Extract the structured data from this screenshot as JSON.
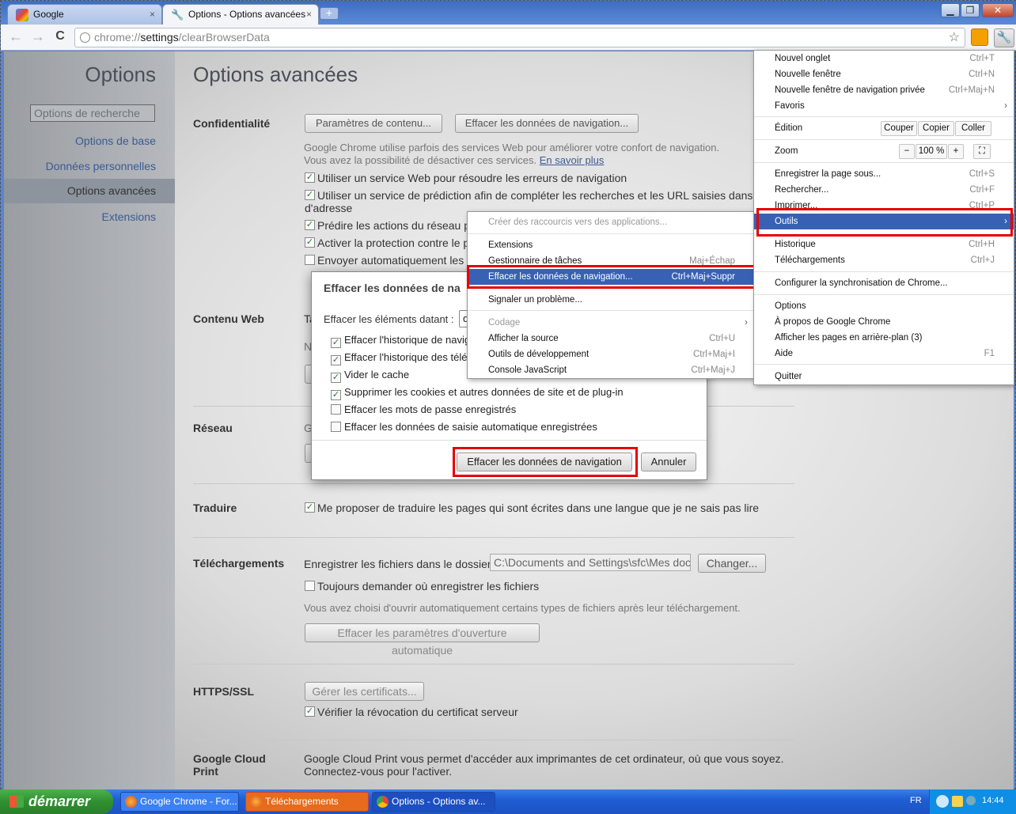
{
  "tabs": [
    {
      "title": "Google",
      "close": "×"
    },
    {
      "title": "Options - Options avancées",
      "close": "×"
    }
  ],
  "new_tab_label": "+",
  "window_controls": {
    "minimize": "▁",
    "maximize": "❐",
    "close": "✕"
  },
  "toolbar": {
    "back": "←",
    "forward": "→",
    "reload": "C",
    "url_scheme": "chrome://",
    "url_host": "settings",
    "url_path": "/clearBrowserData",
    "star": "☆",
    "wrench": "🔧"
  },
  "sidebar": {
    "title": "Options",
    "search_placeholder": "Options de recherche",
    "items": [
      {
        "label": "Options de base"
      },
      {
        "label": "Données personnelles"
      },
      {
        "label": "Options avancées"
      },
      {
        "label": "Extensions"
      }
    ]
  },
  "main": {
    "title": "Options avancées",
    "confidentialite": {
      "heading": "Confidentialité",
      "btn_contenu": "Paramètres de contenu...",
      "btn_effacer": "Effacer les données de navigation...",
      "desc1": "Google Chrome utilise parfois des services Web pour améliorer votre confort de navigation.",
      "desc2": "Vous avez la possibilité de désactiver ces services.",
      "learn_more": "En savoir plus",
      "options": [
        {
          "label": "Utiliser un service Web pour résoudre les erreurs de navigation",
          "checked": "✓"
        },
        {
          "label": "Utiliser un service de prédiction afin de compléter les recherches et les URL saisies dans la barre",
          "checked": "✓"
        },
        {
          "label": "d'adresse",
          "checked": ""
        },
        {
          "label": "Prédire les actions du réseau pour",
          "checked": "✓"
        },
        {
          "label": "Activer la protection contre le phi",
          "checked": "✓"
        },
        {
          "label": "Envoyer automatiquement les sta",
          "checked": ""
        }
      ]
    },
    "contenu_web": {
      "heading": "Contenu Web",
      "frag1": "Ta",
      "frag2": "N"
    },
    "reseau": {
      "heading": "Réseau",
      "frag": "G"
    },
    "traduire": {
      "heading": "Traduire",
      "option": "Me proposer de traduire les pages qui sont écrites dans une langue que je ne sais pas lire",
      "checked": "✓"
    },
    "telechargements": {
      "heading": "Téléchargements",
      "label": "Enregistrer les fichiers dans le dossier :",
      "path": "C:\\Documents and Settings\\sfc\\Mes docur",
      "change": "Changer...",
      "ask": "Toujours demander où enregistrer les fichiers",
      "auto_desc": "Vous avez choisi d'ouvrir automatiquement certains types de fichiers après leur téléchargement.",
      "reset": "Effacer les paramètres d'ouverture automatique"
    },
    "https": {
      "heading": "HTTPS/SSL",
      "manage": "Gérer les certificats...",
      "revocation": "Vérifier la révocation du certificat serveur",
      "checked": "✓"
    },
    "cloud": {
      "heading1": "Google Cloud",
      "heading2": "Print",
      "desc1": "Google Cloud Print vous permet d'accéder aux imprimantes de cet ordinateur, où que vous soyez.",
      "desc2": "Connectez-vous pour l'activer."
    }
  },
  "dialog": {
    "title": "Effacer les données de na",
    "period_label": "Effacer les éléments datant :",
    "period_value": "d",
    "items": [
      {
        "label": "Effacer l'historique de navig",
        "checked": "✓"
      },
      {
        "label": "Effacer l'historique des télé",
        "checked": "✓"
      },
      {
        "label": "Vider le cache",
        "checked": "✓"
      },
      {
        "label": "Supprimer les cookies et autres données de site et de plug-in",
        "checked": "✓"
      },
      {
        "label": "Effacer les mots de passe enregistrés",
        "checked": ""
      },
      {
        "label": "Effacer les données de saisie automatique enregistrées",
        "checked": ""
      }
    ],
    "confirm": "Effacer les données de navigation",
    "cancel": "Annuler"
  },
  "tools_menu": {
    "items": [
      {
        "label": "Créer des raccourcis vers des applications...",
        "shortcut": ""
      },
      {
        "label": "Extensions",
        "shortcut": ""
      },
      {
        "label": "Gestionnaire de tâches",
        "shortcut": "Maj+Échap"
      },
      {
        "label": "Effacer les données de navigation...",
        "shortcut": "Ctrl+Maj+Suppr"
      },
      {
        "label": "Signaler un problème...",
        "shortcut": ""
      },
      {
        "label": "Codage",
        "shortcut": ""
      },
      {
        "label": "Afficher la source",
        "shortcut": "Ctrl+U"
      },
      {
        "label": "Outils de développement",
        "shortcut": "Ctrl+Maj+I"
      },
      {
        "label": "Console JavaScript",
        "shortcut": "Ctrl+Maj+J"
      }
    ],
    "submenu_arrow": "›"
  },
  "wrench_menu": {
    "items": [
      {
        "label": "Nouvel onglet",
        "shortcut": "Ctrl+T"
      },
      {
        "label": "Nouvelle fenêtre",
        "shortcut": "Ctrl+N"
      },
      {
        "label": "Nouvelle fenêtre de navigation privée",
        "shortcut": "Ctrl+Maj+N"
      },
      {
        "label": "Favoris",
        "shortcut": ""
      },
      {
        "label": "Édition",
        "shortcut": ""
      },
      {
        "label": "Zoom",
        "shortcut": ""
      },
      {
        "label": "Enregistrer la page sous...",
        "shortcut": "Ctrl+S"
      },
      {
        "label": "Rechercher...",
        "shortcut": "Ctrl+F"
      },
      {
        "label": "Imprimer...",
        "shortcut": "Ctrl+P"
      },
      {
        "label": "Outils",
        "shortcut": ""
      },
      {
        "label": "Historique",
        "shortcut": "Ctrl+H"
      },
      {
        "label": "Téléchargements",
        "shortcut": "Ctrl+J"
      },
      {
        "label": "Configurer la synchronisation de Chrome...",
        "shortcut": ""
      },
      {
        "label": "Options",
        "shortcut": ""
      },
      {
        "label": "À propos de Google Chrome",
        "shortcut": ""
      },
      {
        "label": "Afficher les pages en arrière-plan (3)",
        "shortcut": ""
      },
      {
        "label": "Aide",
        "shortcut": "F1"
      },
      {
        "label": "Quitter",
        "shortcut": ""
      }
    ],
    "edit": {
      "cut": "Couper",
      "copy": "Copier",
      "paste": "Coller"
    },
    "zoom": {
      "minus": "−",
      "level": "100 %",
      "plus": "+",
      "fullscreen": "⛶"
    },
    "submenu_arrow": "›"
  },
  "taskbar": {
    "start": "démarrer",
    "buttons": [
      {
        "label": "Google Chrome - For..."
      },
      {
        "label": "Téléchargements"
      },
      {
        "label": "Options - Options av..."
      }
    ],
    "lang": "FR",
    "time": "14:44"
  }
}
